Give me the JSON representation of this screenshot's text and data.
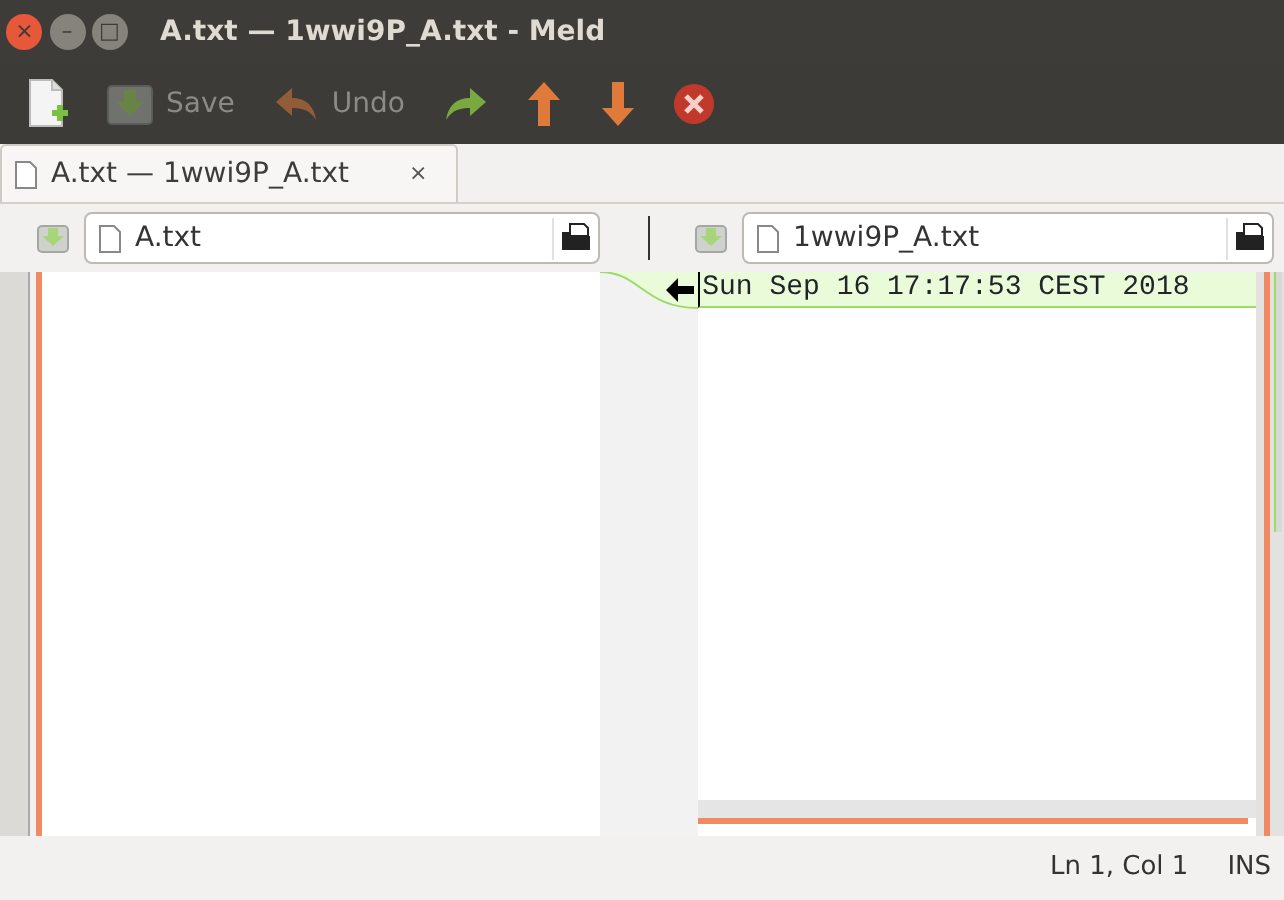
{
  "window": {
    "title": "A.txt — 1wwi9P_A.txt - Meld",
    "controls": [
      "×",
      "–",
      "□"
    ]
  },
  "toolbar": [
    {
      "kind": "new",
      "disabled": false
    },
    {
      "kind": "save",
      "label": "Save",
      "disabled": true
    },
    {
      "kind": "undo",
      "label": "Undo",
      "disabled": true
    },
    {
      "kind": "redo",
      "disabled": false
    },
    {
      "kind": "up",
      "disabled": false
    },
    {
      "kind": "down",
      "disabled": false
    },
    {
      "kind": "stop",
      "disabled": false
    }
  ],
  "tabs": [
    {
      "label": "A.txt — 1wwi9P_A.txt",
      "selected": true,
      "close": "×"
    }
  ],
  "panes": [
    {
      "file": "A.txt"
    },
    {
      "file": "1wwi9P_A.txt",
      "lines": [
        {
          "text": "Sun Sep 16 17:17:53 CEST 2018",
          "kind": "insert"
        }
      ]
    }
  ],
  "status_bar": {
    "position": "Ln 1, Col 1",
    "mode": "INS"
  }
}
